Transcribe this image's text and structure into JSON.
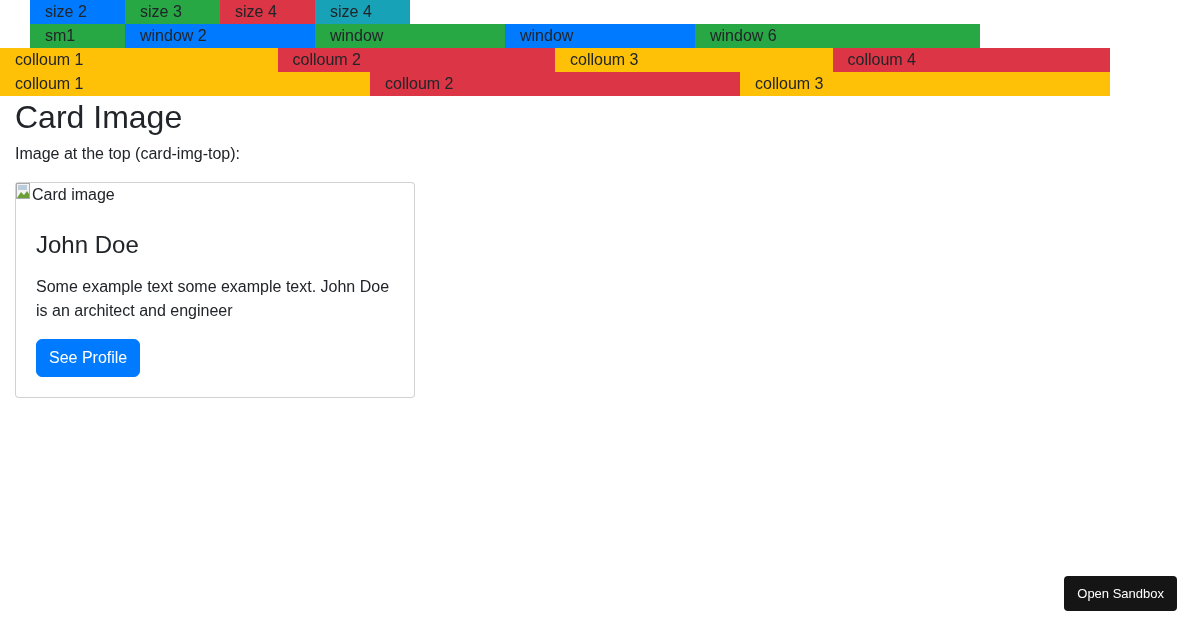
{
  "grid_rows": [
    {
      "cells": [
        {
          "label": "size 2",
          "color": "#007bff"
        },
        {
          "label": "size 3",
          "color": "#28a745"
        },
        {
          "label": "size 4",
          "color": "#dc3545"
        },
        {
          "label": "size 4",
          "color": "#17a2b8"
        }
      ]
    },
    {
      "cells": [
        {
          "label": "sm1",
          "color": "#28a745"
        },
        {
          "label": "window 2",
          "color": "#007bff"
        },
        {
          "label": "window",
          "color": "#28a745"
        },
        {
          "label": "window",
          "color": "#007bff"
        },
        {
          "label": "window 6",
          "color": "#28a745"
        }
      ]
    },
    {
      "cells": [
        {
          "label": "colloum 1",
          "color": "#ffc107"
        },
        {
          "label": "colloum 2",
          "color": "#dc3545"
        },
        {
          "label": "colloum 3",
          "color": "#ffc107"
        },
        {
          "label": "colloum 4",
          "color": "#dc3545"
        }
      ]
    },
    {
      "cells": [
        {
          "label": "colloum 1",
          "color": "#ffc107"
        },
        {
          "label": "colloum 2",
          "color": "#dc3545"
        },
        {
          "label": "colloum 3",
          "color": "#ffc107"
        }
      ]
    }
  ],
  "heading": "Card Image",
  "intro": "Image at the top (card-img-top):",
  "card": {
    "image_alt": "Card image",
    "title": "John Doe",
    "text": "Some example text some example text. John Doe is an architect and engineer",
    "button": "See Profile"
  },
  "sandbox_button": "Open Sandbox"
}
